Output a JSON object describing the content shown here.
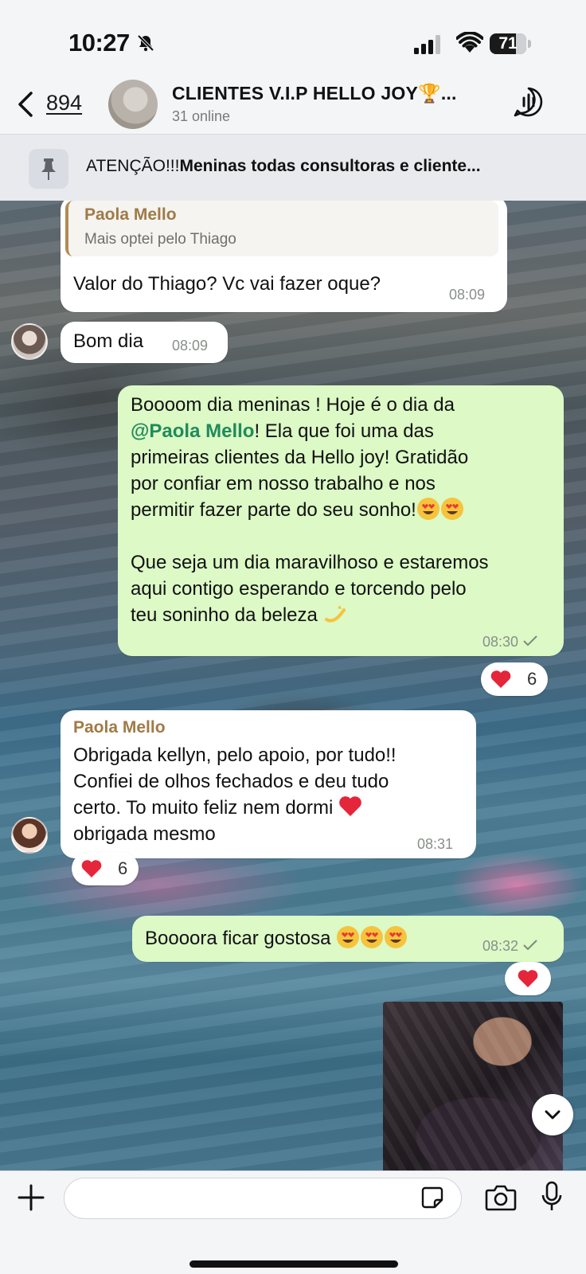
{
  "status_bar": {
    "time": "10:27",
    "battery": "71",
    "battery_level": 0.71
  },
  "header": {
    "back_count": "894",
    "group_name": "CLIENTES V.I.P HELLO JOY🏆...",
    "subtitle": "31 online"
  },
  "pinned": {
    "prefix": "ATENÇÃO!!!",
    "text": "Meninas todas consultoras e cliente..."
  },
  "messages": [
    {
      "reply_to_name": "Paola Mello",
      "reply_to_text": "Mais optei pelo Thiago",
      "text": "Valor do Thiago? Vc vai fazer oque?",
      "time": "08:09"
    },
    {
      "text": "Bom dia",
      "time": "08:09"
    },
    {
      "lines": [
        "Boooom dia meninas ! Hoje é o dia da",
        "@Paola Mello",
        "! Ela que foi uma das",
        "primeiras clientes da Hello joy! Gratidão",
        "por confiar em nosso trabalho e nos",
        "permitir fazer parte do seu sonho!",
        "Que seja um dia maravilhoso e estaremos",
        "aqui contigo esperando e torcendo pelo",
        "teu soninho da beleza"
      ],
      "time": "08:30",
      "reaction_count": "6"
    },
    {
      "sender": "Paola Mello",
      "lines": [
        "Obrigada kellyn, pelo apoio, por tudo!!",
        "Confiei de olhos fechados e deu tudo",
        "certo. To muito feliz nem dormi",
        "obrigada mesmo"
      ],
      "time": "08:31",
      "reaction_count": "6"
    },
    {
      "text": "Boooora ficar gostosa",
      "time": "08:32"
    }
  ],
  "colors": {
    "outgoing_bubble": "#dcf9c6",
    "incoming_bubble": "#ffffff",
    "sender_name": "#a07a46",
    "mention": "#1f8b5a"
  },
  "composer": {
    "placeholder": ""
  }
}
